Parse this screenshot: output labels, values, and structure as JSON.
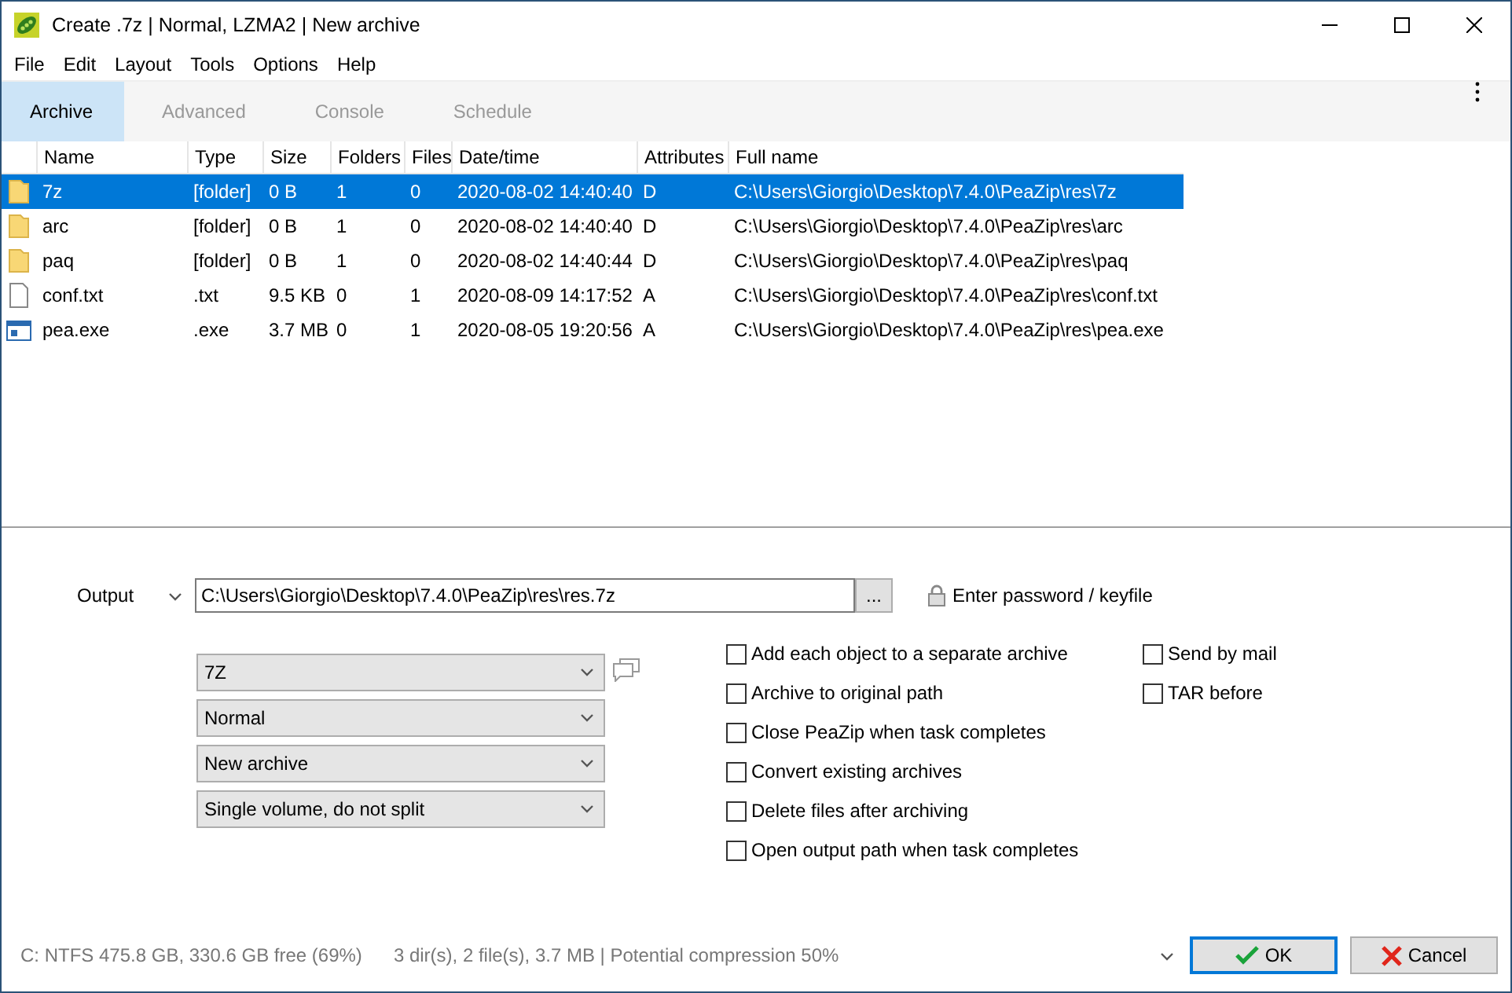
{
  "window": {
    "title": "Create .7z | Normal, LZMA2 | New archive"
  },
  "menu": [
    "File",
    "Edit",
    "Layout",
    "Tools",
    "Options",
    "Help"
  ],
  "tabs": [
    {
      "label": "Archive",
      "selected": true
    },
    {
      "label": "Advanced",
      "selected": false
    },
    {
      "label": "Console",
      "selected": false
    },
    {
      "label": "Schedule",
      "selected": false
    }
  ],
  "table": {
    "columns": [
      "Name",
      "Type",
      "Size",
      "Folders",
      "Files",
      "Date/time",
      "Attributes",
      "Full name"
    ],
    "rows": [
      {
        "kind": "folder",
        "selected": true,
        "cells": [
          "7z",
          "[folder]",
          "0 B",
          "1",
          "0",
          "2020-08-02 14:40:40",
          "D",
          "C:\\Users\\Giorgio\\Desktop\\7.4.0\\PeaZip\\res\\7z"
        ]
      },
      {
        "kind": "folder",
        "selected": false,
        "cells": [
          "arc",
          "[folder]",
          "0 B",
          "1",
          "0",
          "2020-08-02 14:40:40",
          "D",
          "C:\\Users\\Giorgio\\Desktop\\7.4.0\\PeaZip\\res\\arc"
        ]
      },
      {
        "kind": "folder",
        "selected": false,
        "cells": [
          "paq",
          "[folder]",
          "0 B",
          "1",
          "0",
          "2020-08-02 14:40:44",
          "D",
          "C:\\Users\\Giorgio\\Desktop\\7.4.0\\PeaZip\\res\\paq"
        ]
      },
      {
        "kind": "text",
        "selected": false,
        "cells": [
          "conf.txt",
          ".txt",
          "9.5 KB",
          "0",
          "1",
          "2020-08-09 14:17:52",
          "A",
          "C:\\Users\\Giorgio\\Desktop\\7.4.0\\PeaZip\\res\\conf.txt"
        ]
      },
      {
        "kind": "program",
        "selected": false,
        "cells": [
          "pea.exe",
          ".exe",
          "3.7 MB",
          "0",
          "1",
          "2020-08-05 19:20:56",
          "A",
          "C:\\Users\\Giorgio\\Desktop\\7.4.0\\PeaZip\\res\\pea.exe"
        ]
      }
    ]
  },
  "output": {
    "label": "Output",
    "value": "C:\\Users\\Giorgio\\Desktop\\7.4.0\\PeaZip\\res\\res.7z",
    "browse": "...",
    "password": "Enter password / keyfile"
  },
  "dropdowns": [
    "7Z",
    "Normal",
    "New archive",
    "Single volume, do not split"
  ],
  "options_left": [
    {
      "label": "Add each object to a separate archive",
      "checked": false
    },
    {
      "label": "Archive to original path",
      "checked": false
    },
    {
      "label": "Close PeaZip when task completes",
      "checked": false
    },
    {
      "label": "Convert existing archives",
      "checked": false
    },
    {
      "label": "Delete files after archiving",
      "checked": false
    },
    {
      "label": "Open output path when task completes",
      "checked": false
    }
  ],
  "options_right": [
    {
      "label": "Send by mail",
      "checked": false
    },
    {
      "label": "TAR before",
      "checked": false
    }
  ],
  "status_bar": {
    "disk": "C: NTFS 475.8 GB, 330.6 GB free (69%)",
    "summary": "3 dir(s), 2 file(s), 3.7 MB | Potential compression 50%"
  },
  "buttons": {
    "ok": "OK",
    "cancel": "Cancel"
  }
}
